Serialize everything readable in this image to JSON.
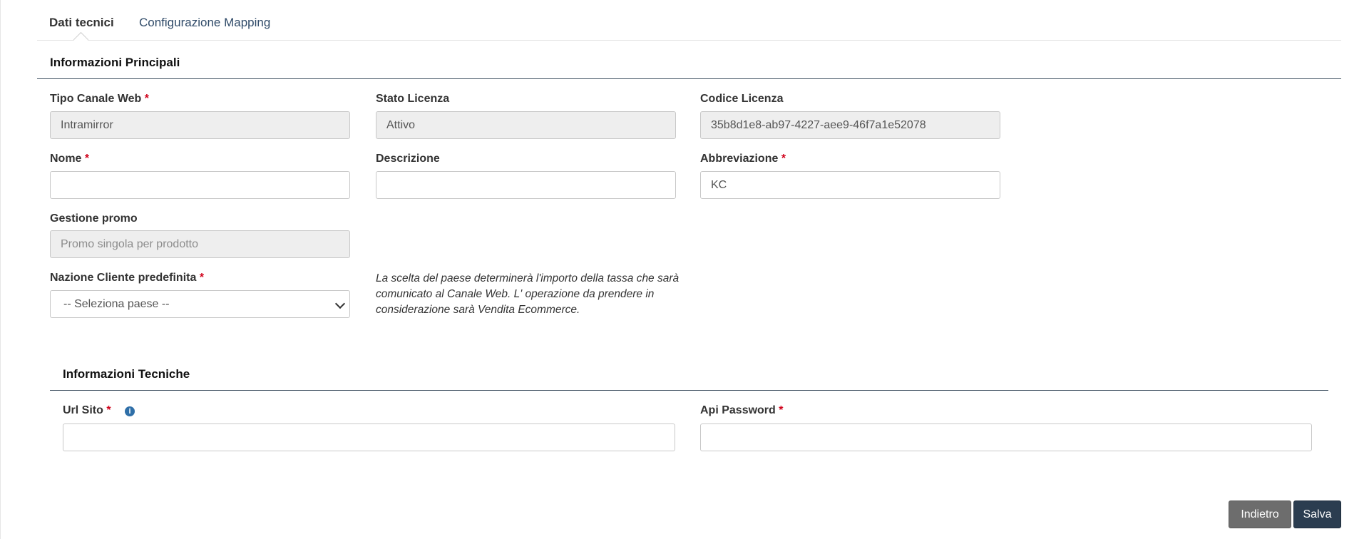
{
  "tabs": [
    {
      "label": "Dati tecnici",
      "active": true
    },
    {
      "label": "Configurazione Mapping",
      "active": false
    }
  ],
  "main_info": {
    "title": "Informazioni Principali",
    "tipo_canale": {
      "label": "Tipo Canale Web",
      "required": "*",
      "value": "Intramirror"
    },
    "stato_licenza": {
      "label": "Stato Licenza",
      "value": "Attivo"
    },
    "codice_licenza": {
      "label": "Codice Licenza",
      "value": "35b8d1e8-ab97-4227-aee9-46f7a1e52078"
    },
    "nome": {
      "label": "Nome",
      "required": "*",
      "value": ""
    },
    "descrizione": {
      "label": "Descrizione",
      "value": ""
    },
    "abbreviazione": {
      "label": "Abbreviazione",
      "required": "*",
      "value": "KC"
    },
    "gestione_promo": {
      "label": "Gestione promo",
      "placeholder": "Promo singola per prodotto"
    },
    "nazione": {
      "label": "Nazione Cliente predefinita",
      "required": "*",
      "selected": "-- Seleziona paese --"
    },
    "hint": "La scelta del paese determinerà l'importo della tassa che sarà comunicato al Canale Web. L' operazione da prendere in considerazione sarà Vendita Ecommerce."
  },
  "tech_info": {
    "title": "Informazioni Tecniche",
    "url_sito": {
      "label": "Url Sito",
      "required": "*",
      "value": "",
      "info_icon": "info-icon"
    },
    "api_password": {
      "label": "Api Password",
      "required": "*",
      "value": ""
    }
  },
  "actions": {
    "back_label": "Indietro",
    "save_label": "Salva"
  },
  "colors": {
    "primary": "#2b3d50",
    "secondary": "#6d6d6d",
    "required": "#d0021b",
    "link": "#2f4a68"
  }
}
